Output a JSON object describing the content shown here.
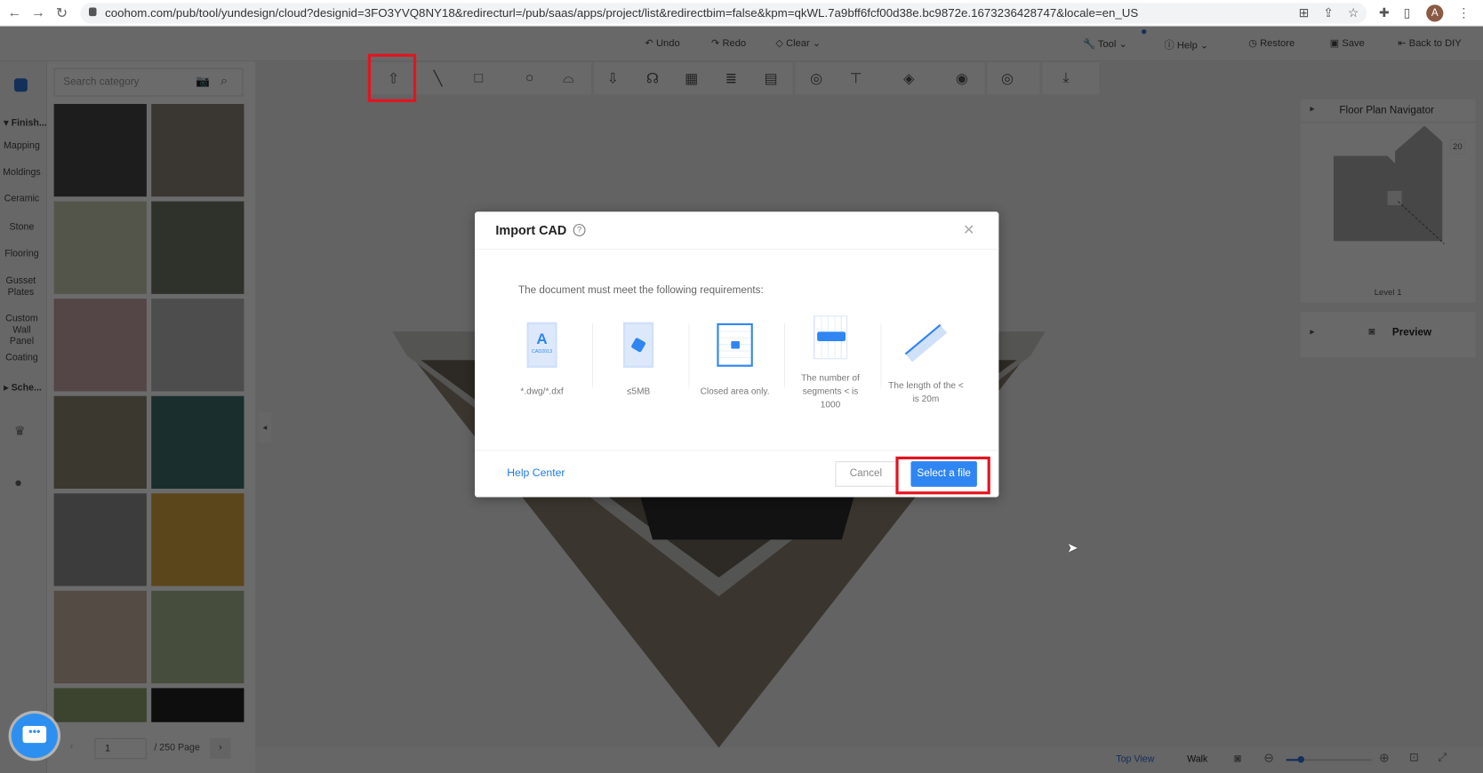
{
  "browser": {
    "url": "coohom.com/pub/tool/yundesign/cloud?designid=3FO3YVQ8NY18&redirecturl=/pub/saas/apps/project/list&redirectbim=false&kpm=qkWL.7a9bff6fcf00d38e.bc9872e.1673236428747&locale=en_US",
    "avatar": "A"
  },
  "topbar": {
    "undo": "Undo",
    "redo": "Redo",
    "clear": "Clear",
    "tool": "Tool",
    "help": "Help",
    "restore": "Restore",
    "save": "Save",
    "back": "Back to DIY"
  },
  "sidebar": {
    "search_placeholder": "Search category",
    "categories": [
      "Finish...",
      "Mapping",
      "Moldings",
      "Ceramic",
      "Stone",
      "Flooring",
      "Gusset Plates",
      "Custom Wall Panel",
      "Coating",
      "Sche..."
    ],
    "pagination": {
      "page": "1",
      "total": "/ 250 Page"
    }
  },
  "colors": {
    "accent": "#2f86f2",
    "highlight": "#e3141e"
  },
  "tiles": [
    "#444",
    "#8a8279",
    "#c9cbb0",
    "#6f7566",
    "#c9a5a8",
    "#b8b8b8",
    "#8d8570",
    "#3d6d6a",
    "#8f9092",
    "#d9a53e",
    "#c5b2a2",
    "#aab890",
    "#8fa070",
    "#222"
  ],
  "right": {
    "navigator_title": "Floor Plan Navigator",
    "zoom": "20",
    "level": "Level 1",
    "preview": "Preview"
  },
  "bottom": {
    "top_view": "Top View",
    "walk": "Walk",
    "zoom_level": 0.15
  },
  "dialog": {
    "title": "Import CAD",
    "requirements_intro": "The document must meet the following requirements:",
    "requirements": [
      {
        "label": "*.dwg/*.dxf",
        "icon_text": "A",
        "icon_sub": "CAD2013"
      },
      {
        "label": "≤5MB"
      },
      {
        "label": "Closed area only."
      },
      {
        "label": "The number of segments < is 1000"
      },
      {
        "label": "The length of the < is 20m"
      }
    ],
    "help_center": "Help Center",
    "cancel": "Cancel",
    "select_file": "Select a file"
  }
}
